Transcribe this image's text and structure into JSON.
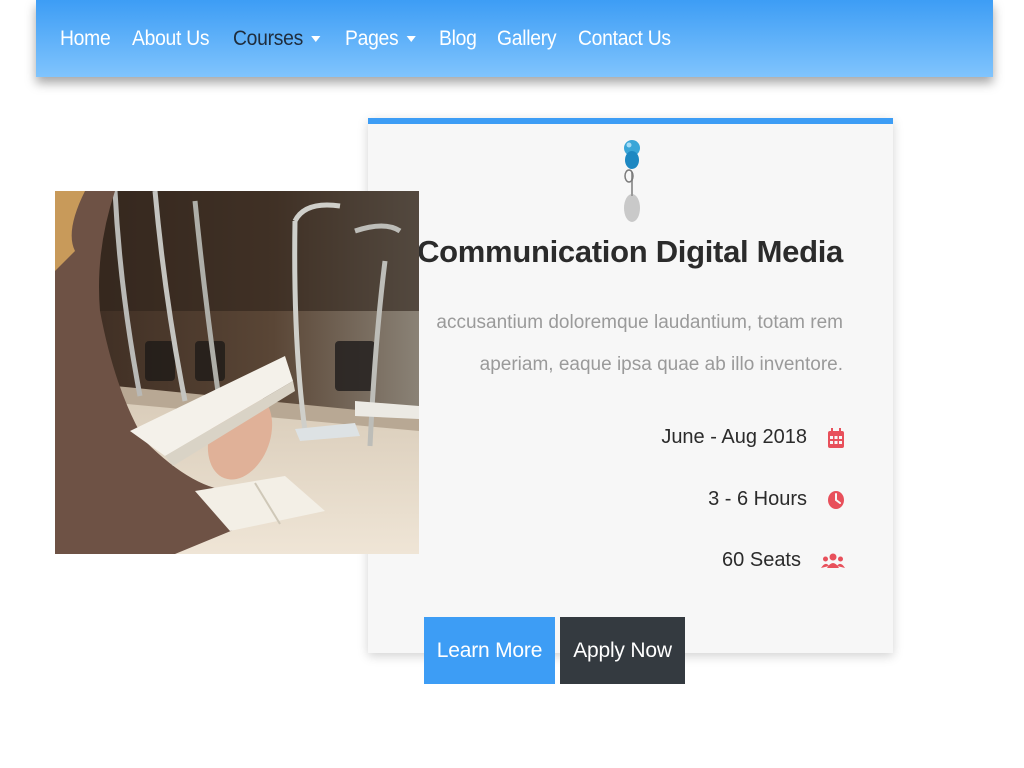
{
  "nav": {
    "items": [
      {
        "label": "Home"
      },
      {
        "label": "About Us"
      },
      {
        "label": "Courses"
      },
      {
        "label": "Pages"
      },
      {
        "label": "Blog"
      },
      {
        "label": "Gallery"
      },
      {
        "label": "Contact Us"
      }
    ]
  },
  "course": {
    "title": "Communication Digital Media",
    "description": "accusantium doloremque laudantium, totam rem aperiam, eaque ipsa quae ab illo inventore.",
    "date": "June - Aug 2018",
    "duration": "3 - 6 Hours",
    "seats": "60 Seats",
    "icons": {
      "date": "calendar-icon",
      "duration": "clock-icon",
      "seats": "users-icon",
      "pin": "pushpin-icon"
    }
  },
  "buttons": {
    "learn_more": "Learn More",
    "apply_now": "Apply Now"
  },
  "colors": {
    "accent": "#3d9df5",
    "dark_button": "#343a40",
    "icon_red": "#e8505b"
  }
}
